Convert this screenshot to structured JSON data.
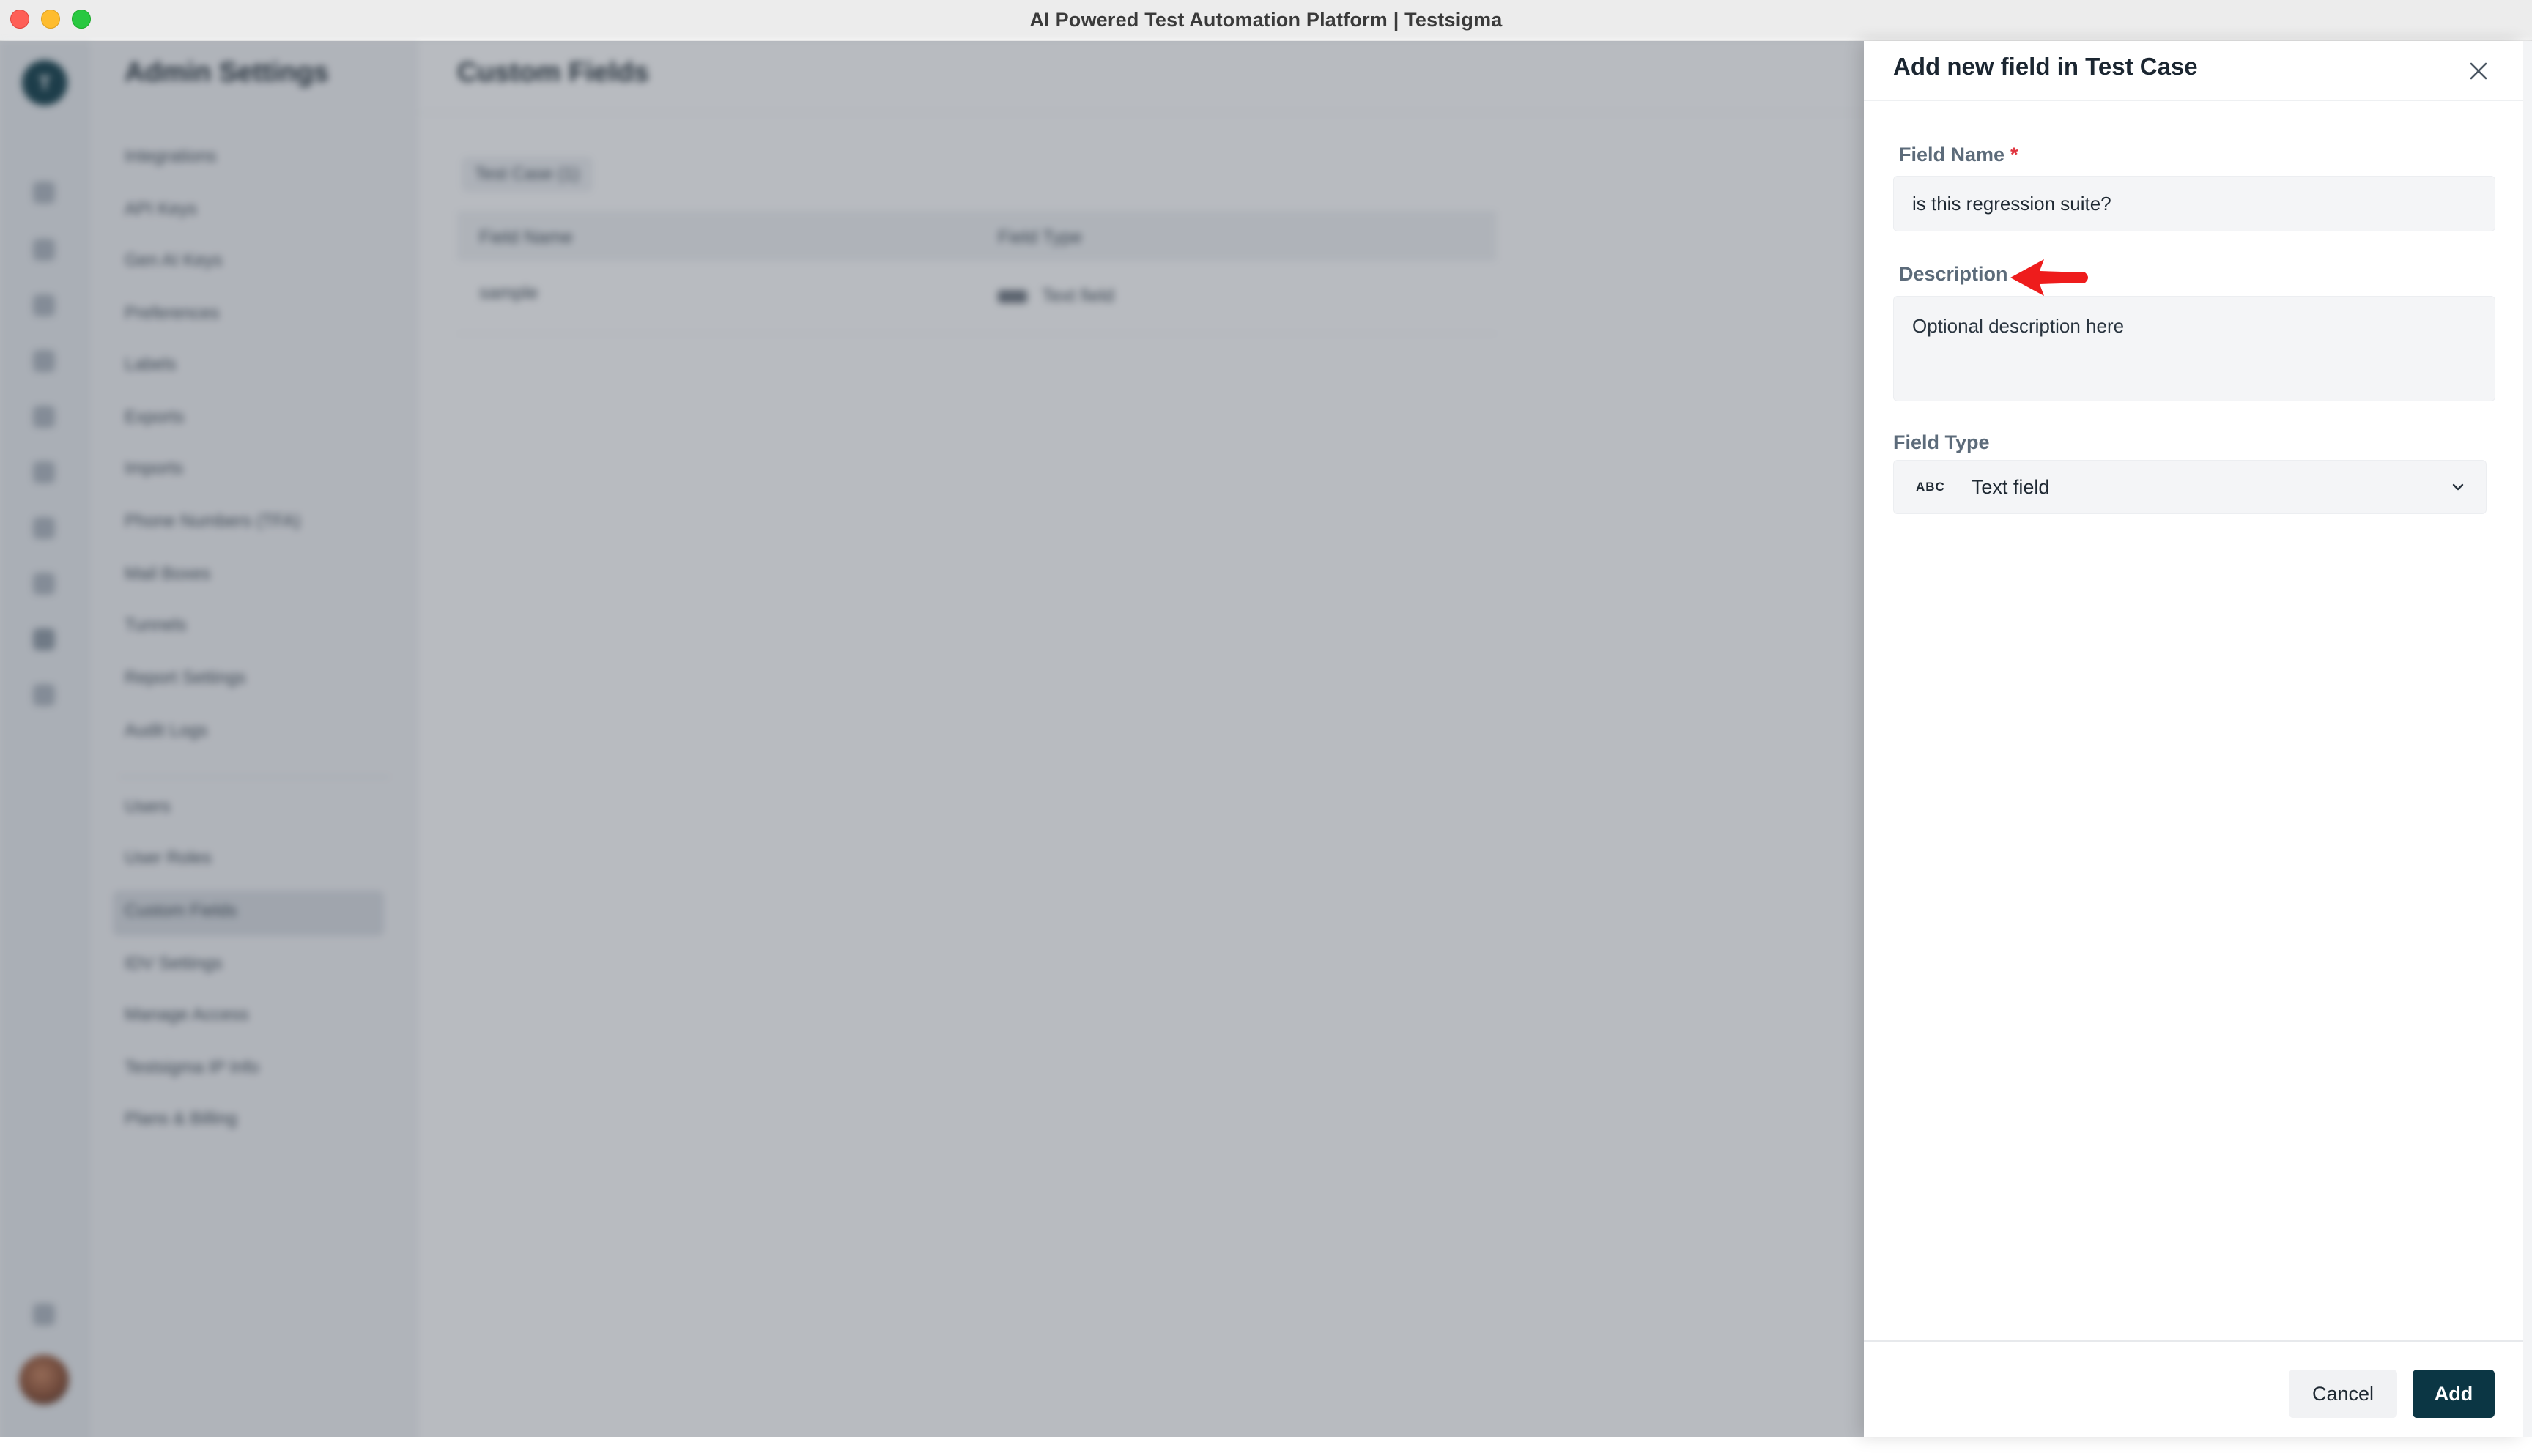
{
  "window": {
    "title": "AI Powered Test Automation Platform | Testsigma"
  },
  "rail": {
    "logo_letter": "T"
  },
  "settings_menu": {
    "title": "Admin Settings",
    "items": [
      "Integrations",
      "API Keys",
      "Gen AI Keys",
      "Preferences",
      "Labels",
      "Exports",
      "Imports",
      "Phone Numbers (TFA)",
      "Mail Boxes",
      "Tunnels",
      "Report Settings",
      "Audit Logs",
      "Users",
      "User Roles",
      "Custom Fields",
      "IDV Settings",
      "Manage Access",
      "Testsigma IP Info",
      "Plans & Billing"
    ],
    "active_item": "Custom Fields"
  },
  "content": {
    "title": "Custom Fields",
    "tab_chip": "Test Case (1)",
    "table": {
      "headers": [
        "Field Name",
        "Field Type"
      ],
      "rows": [
        {
          "name": "sample",
          "type": "Text field"
        }
      ]
    }
  },
  "drawer": {
    "title": "Add new field in Test Case",
    "field_name_label": "Field Name",
    "required_mark": "*",
    "field_name_value": "is this regression suite?",
    "description_label": "Description",
    "description_placeholder": "Optional description here",
    "field_type_label": "Field Type",
    "field_type_icon_text": "ABC",
    "field_type_value": "Text field",
    "cancel_label": "Cancel",
    "add_label": "Add"
  },
  "colors": {
    "primary_button": "#0b3644",
    "required": "#e0343f",
    "annotation_arrow": "#ee1c1c"
  }
}
